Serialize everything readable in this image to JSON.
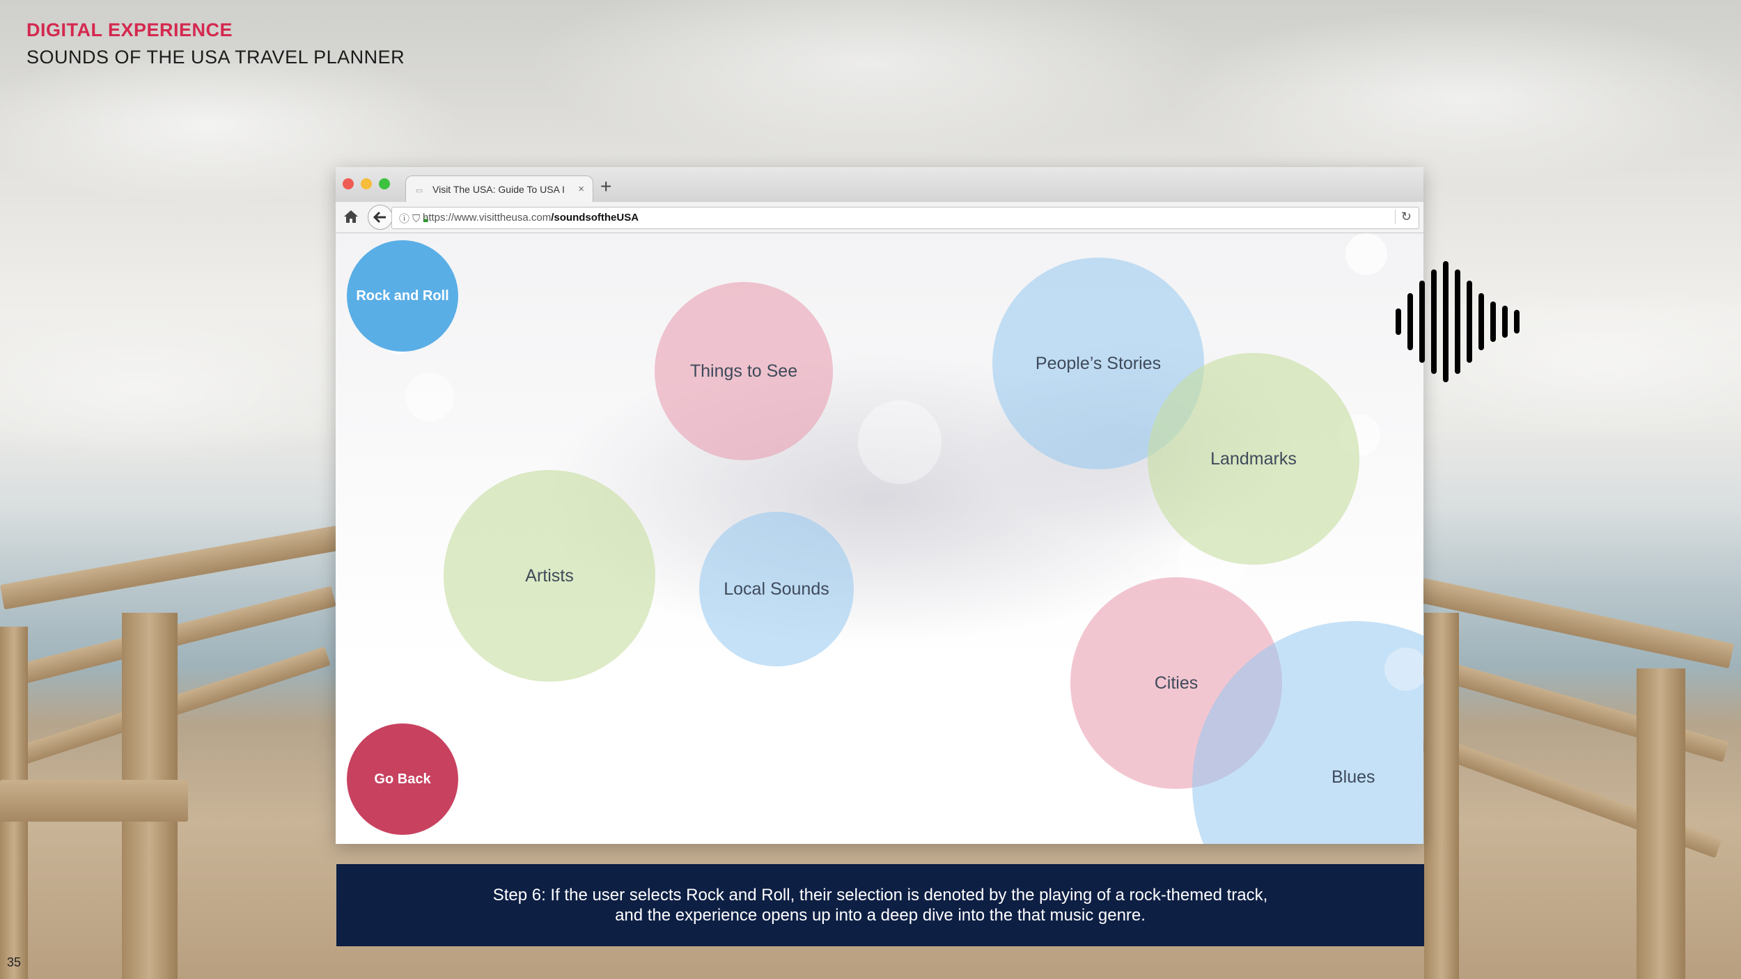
{
  "slide": {
    "kicker": "DIGITAL EXPERIENCE",
    "subtitle": "SOUNDS OF THE USA TRAVEL PLANNER",
    "page_number": "35"
  },
  "browser": {
    "tab_title": "Visit The USA: Guide To USA I",
    "url_prefix": "https://www.visittheusa.com",
    "url_path": "/soundsoftheUSA"
  },
  "app": {
    "rock_button": "Rock and Roll",
    "go_back_button": "Go Back",
    "bubbles": {
      "things_to_see": "Things to See",
      "peoples_stories": "People’s Stories",
      "landmarks": "Landmarks",
      "artists": "Artists",
      "local_sounds": "Local Sounds",
      "cities": "Cities",
      "blues": "Blues"
    }
  },
  "caption": {
    "line1": "Step 6: If the user selects Rock and Roll, their selection is denoted by the playing of a rock-themed track,",
    "line2": "and the experience opens up into a deep dive into the that music genre."
  },
  "colors": {
    "accent": "#d4284f",
    "caption_bg": "#0e1f44",
    "rock_blue": "#5aaee6",
    "go_back_red": "#c8415f"
  },
  "icons": [
    "home-icon",
    "back-arrow-icon",
    "info-icon",
    "shield-icon",
    "lock-icon",
    "reload-icon",
    "sound-wave-icon"
  ]
}
